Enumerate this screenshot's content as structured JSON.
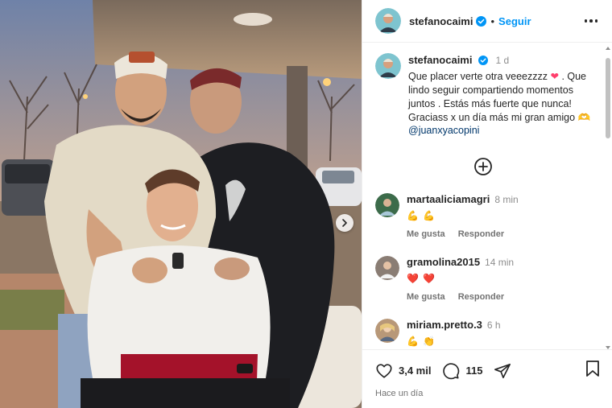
{
  "post": {
    "author": "stefanocaimi",
    "follow_label": "Seguir",
    "dot": "•",
    "caption": {
      "username": "stefanocaimi",
      "time": "1 d",
      "text_part1": "Que placer verte otra veeezzzz ",
      "heart": "❤",
      "text_part2": " . Que lindo seguir compartiendo momentos juntos . Estás más fuerte que nunca! Graciass x un día más mi gran amigo ",
      "emoji_end": "🫶",
      "mention": "@juanxyacopini"
    },
    "likes": "3,4 mil",
    "comment_count": "115",
    "posted_ago": "Hace un día"
  },
  "comments": [
    {
      "username": "martaaliciamagri",
      "time": "8 min",
      "text": "💪 💪",
      "like_label": "Me gusta",
      "reply_label": "Responder"
    },
    {
      "username": "gramolina2015",
      "time": "14 min",
      "text": "❤️ ❤️",
      "like_label": "Me gusta",
      "reply_label": "Responder"
    },
    {
      "username": "miriam.pretto.3",
      "time": "6 h",
      "text": "💪 👏"
    }
  ],
  "colors": {
    "accent": "#0095f6",
    "verified": "#0095f6",
    "mention": "#00376b"
  },
  "icons": [
    "verified-badge-icon",
    "more-options-icon",
    "load-more-comments-icon",
    "heart-icon",
    "comment-icon",
    "share-icon",
    "bookmark-icon",
    "chevron-right-icon"
  ]
}
